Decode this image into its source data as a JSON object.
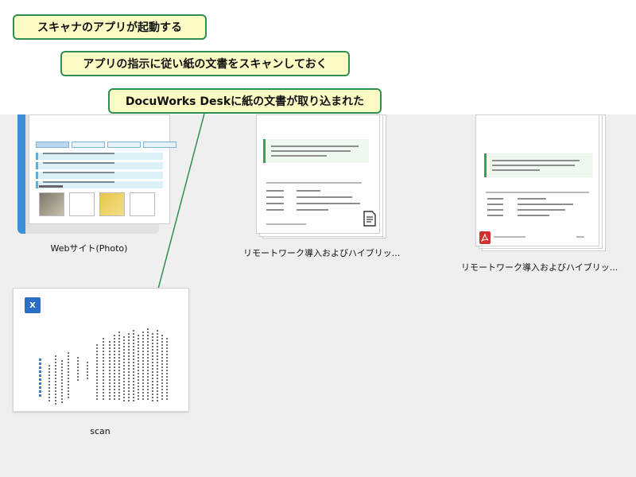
{
  "callouts": {
    "step1": "スキャナのアプリが起動する",
    "step2": "アプリの指示に従い紙の文書をスキャンしておく",
    "step3": "DocuWorks Deskに紙の文書が取り込まれた"
  },
  "files": [
    {
      "name": "Webサイト(Photo)",
      "icon": "binder-icon"
    },
    {
      "name": "リモートワーク導入およびハイブリッ...",
      "icon": "document-icon"
    },
    {
      "name": "リモートワーク導入およびハイブリッ...",
      "icon": "pdf-icon"
    },
    {
      "name": "scan",
      "icon": "docuworks-icon"
    }
  ],
  "colors": {
    "callout_fill": "#fdfcc4",
    "callout_border": "#2f8f52",
    "desk_background": "#efefef",
    "binder_spine": "#3d8fd6",
    "pdf_red": "#d32f2f",
    "docuworks_blue": "#2a6fc2"
  }
}
